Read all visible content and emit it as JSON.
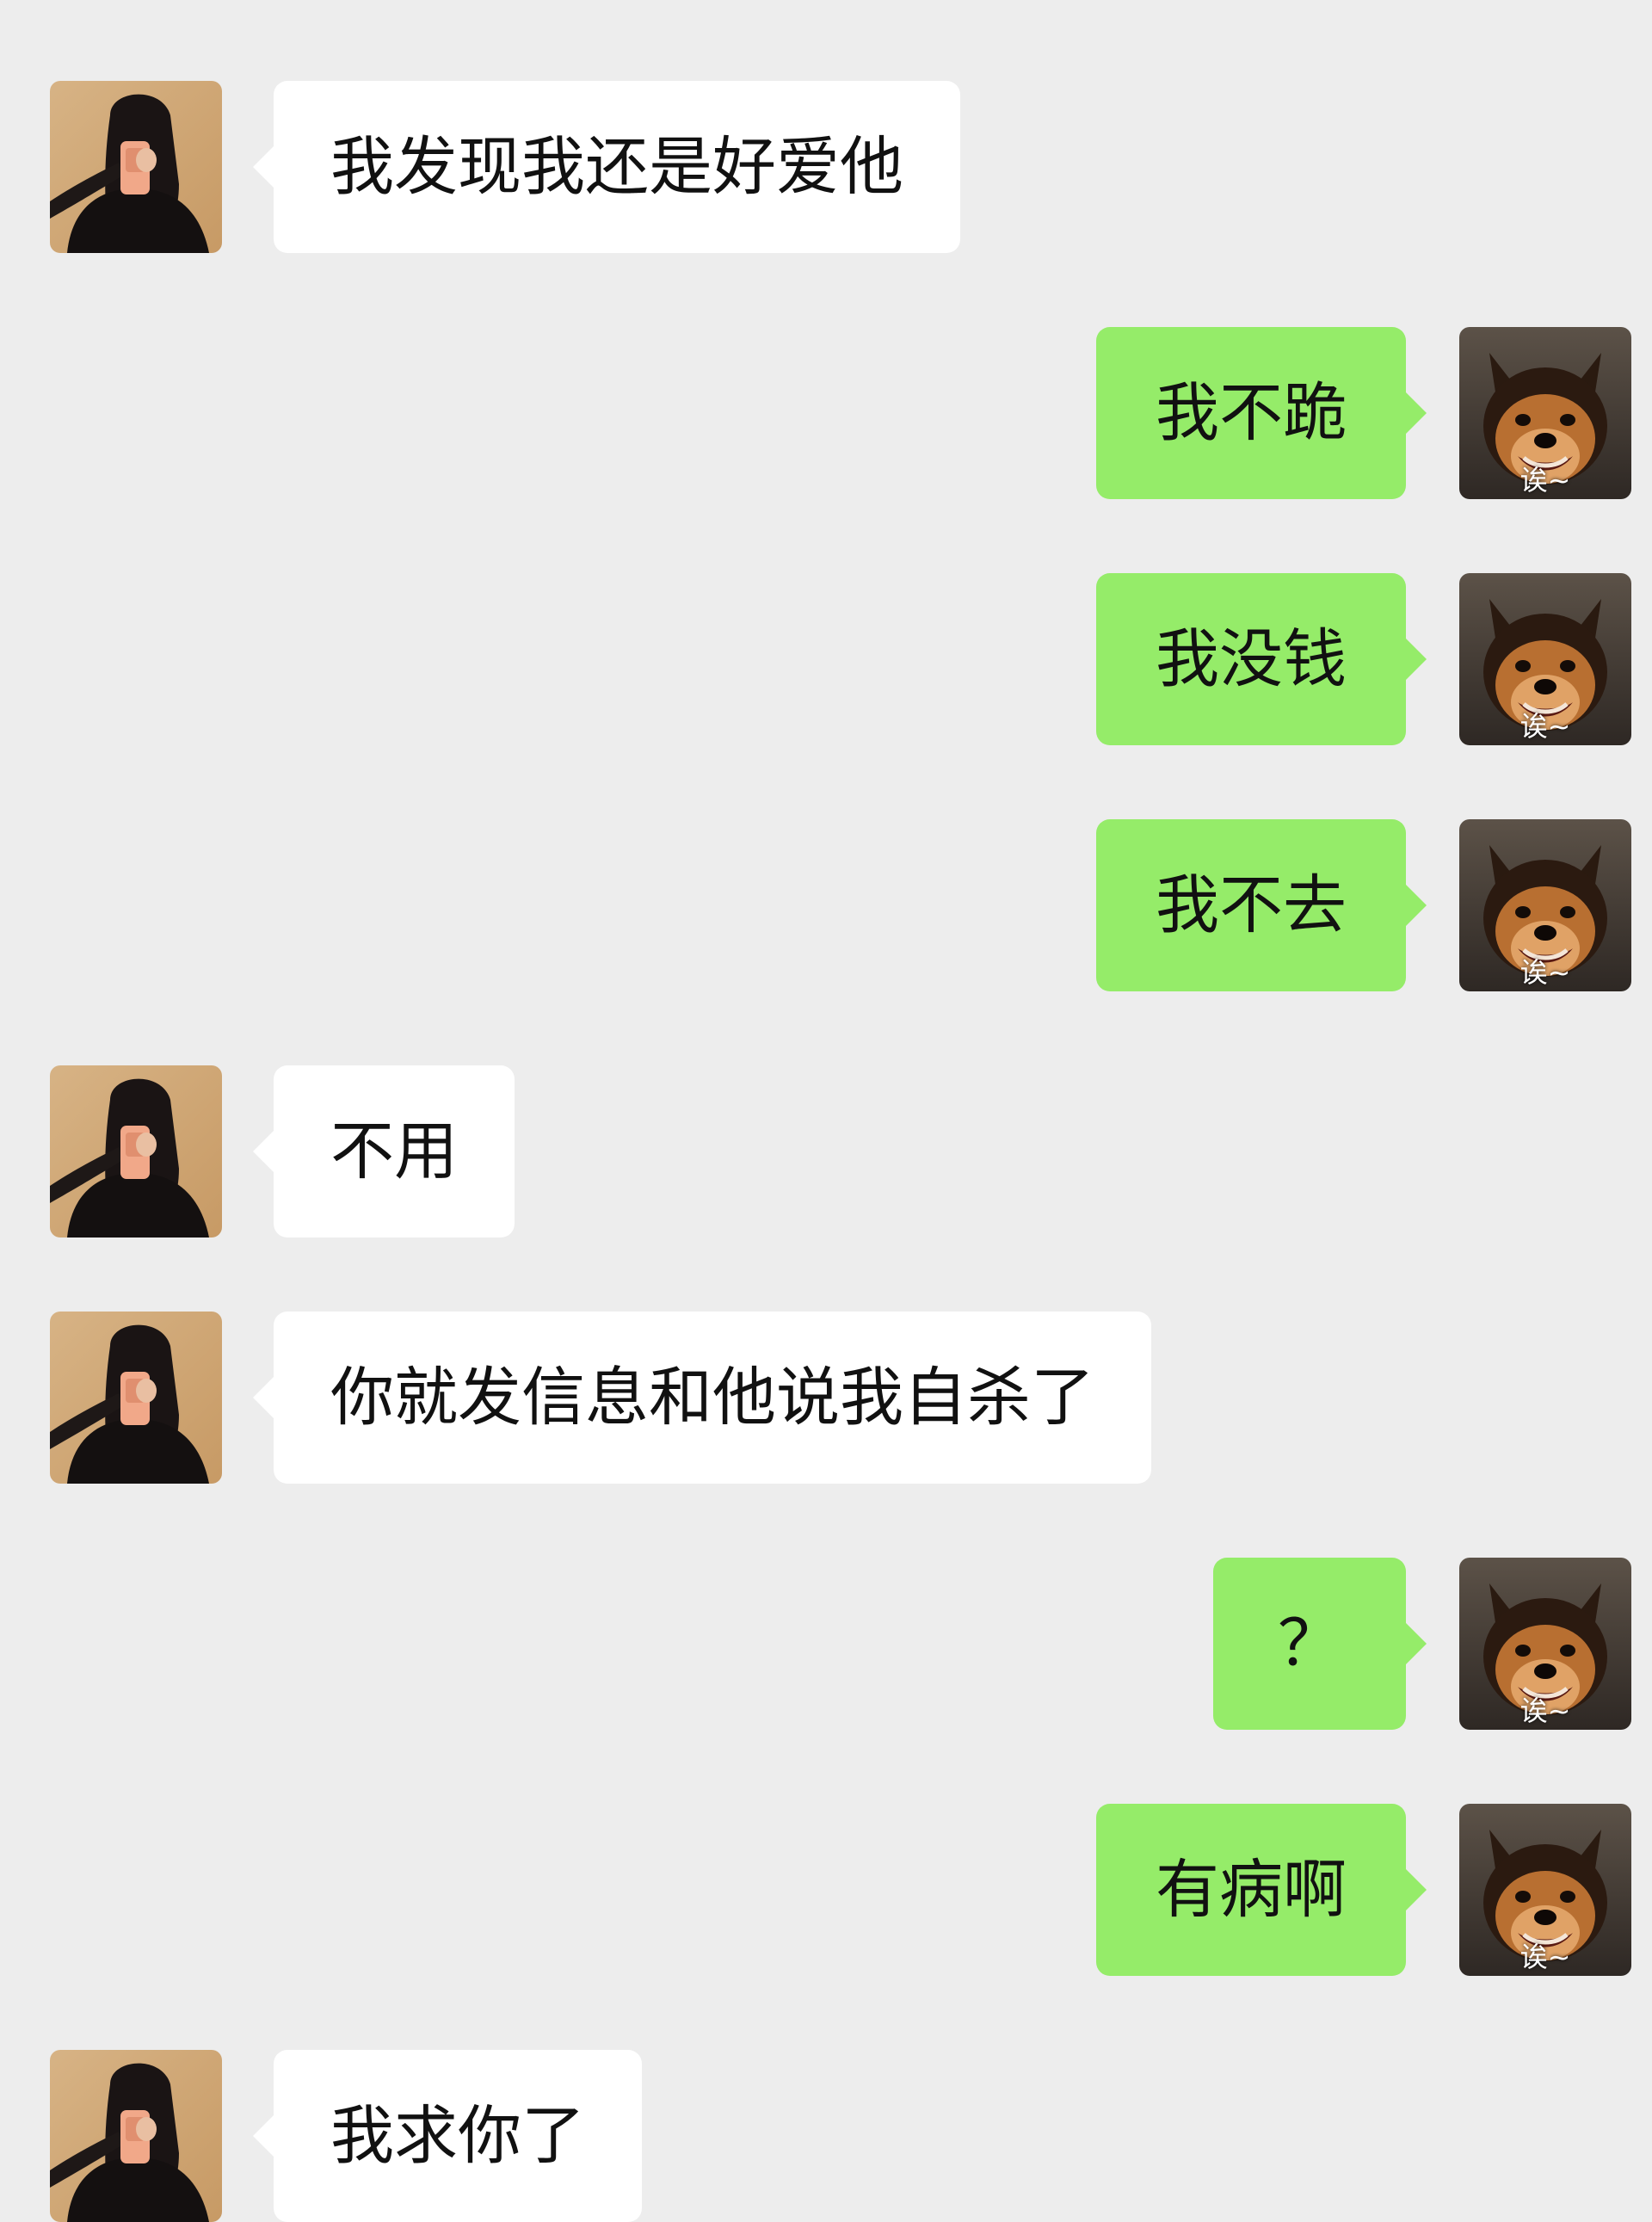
{
  "chat": {
    "messages": [
      {
        "sender": "other",
        "text": "我发现我还是好爱他"
      },
      {
        "sender": "me",
        "text": "我不跪",
        "avatar_caption": "诶~"
      },
      {
        "sender": "me",
        "text": "我没钱",
        "avatar_caption": "诶~"
      },
      {
        "sender": "me",
        "text": "我不去",
        "avatar_caption": "诶~"
      },
      {
        "sender": "other",
        "text": "不用"
      },
      {
        "sender": "other",
        "text": "你就发信息和他说我自杀了"
      },
      {
        "sender": "me",
        "text": "？",
        "avatar_caption": "诶~"
      },
      {
        "sender": "me",
        "text": "有病啊",
        "avatar_caption": "诶~"
      },
      {
        "sender": "other",
        "text": "我求你了"
      }
    ]
  },
  "colors": {
    "background": "#ededed",
    "incoming_bubble": "#ffffff",
    "outgoing_bubble": "#95ec69",
    "text": "#111111"
  },
  "icons": {
    "other_avatar": "woman-selfie-avatar",
    "my_avatar": "smiling-dog-avatar"
  }
}
